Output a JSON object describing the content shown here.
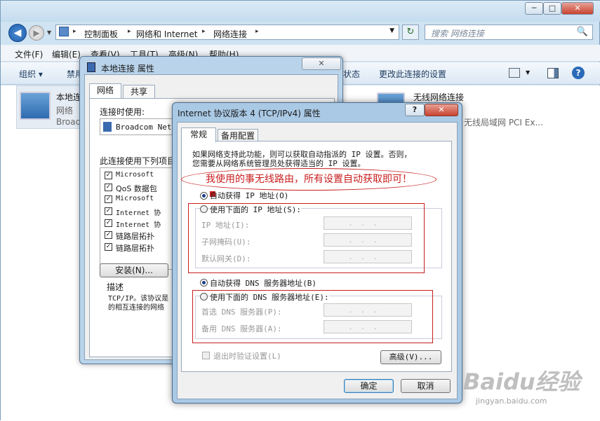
{
  "explorer": {
    "breadcrumb": [
      "控制面板",
      "网络和 Internet",
      "网络连接"
    ],
    "search_placeholder": "搜索 网络连接",
    "menu": [
      "文件(F)",
      "编辑(E)",
      "查看(V)",
      "工具(T)",
      "高级(N)",
      "帮助(H)"
    ],
    "commands": {
      "organize": "组织 ▾",
      "disable": "禁用",
      "status": "状态",
      "rename": "更改此连接的设置"
    },
    "adapters": [
      {
        "name": "本地连",
        "sub1": "网络",
        "sub2": "Broad"
      },
      {
        "name": "无线网络连接",
        "sub1": "",
        "sub2": "无线局域网 PCI Ex..."
      }
    ]
  },
  "props_dialog": {
    "title": "本地连接 属性",
    "close": "✕",
    "tabs": [
      "网络",
      "共享"
    ],
    "connect_using_label": "连接时使用:",
    "adapter": "Broadcom Net",
    "items_label": "此连接使用下列项目",
    "items": [
      {
        "label": "Microsoft",
        "checked": true
      },
      {
        "label": "QoS 数据包",
        "checked": true
      },
      {
        "label": "Microsoft",
        "checked": true
      },
      {
        "label": "Internet 协",
        "checked": true
      },
      {
        "label": "Internet 协",
        "checked": true
      },
      {
        "label": "链路层拓扑",
        "checked": true
      },
      {
        "label": "链路层拓扑",
        "checked": true
      }
    ],
    "install_button": "安装(N)...",
    "description_title": "描述",
    "description_text": [
      "TCP/IP。该协议是",
      "的相互连接的网络"
    ]
  },
  "ipv4_dialog": {
    "title": "Internet 协议版本 4 (TCP/IPv4) 属性",
    "help": "?",
    "close": "✕",
    "tabs": [
      "常规",
      "备用配置"
    ],
    "intro": [
      "如果网络支持此功能，则可以获取自动指派的 IP 设置。否则，",
      "您需要从网络系统管理员处获得适当的 IP 设置。"
    ],
    "annotation": "我使用的事无线路由，所有设置自动获取即可！",
    "auto_ip": "自动获得 IP 地址(O)",
    "manual_ip": "使用下面的 IP 地址(S):",
    "ip_label": "IP 地址(I):",
    "mask_label": "子网掩码(U):",
    "gateway_label": "默认网关(D):",
    "ip_placeholder": "...",
    "auto_dns": "自动获得 DNS 服务器地址(B)",
    "manual_dns": "使用下面的 DNS 服务器地址(E):",
    "dns1_label": "首选 DNS 服务器(P):",
    "dns2_label": "备用 DNS 服务器(A):",
    "validate_label": "退出时验证设置(L)",
    "advanced_button": "高级(V)...",
    "ok_button": "确定",
    "cancel_button": "取消"
  },
  "watermark": {
    "brand": "Baidu经验",
    "url": "jingyan.baidu.com"
  }
}
